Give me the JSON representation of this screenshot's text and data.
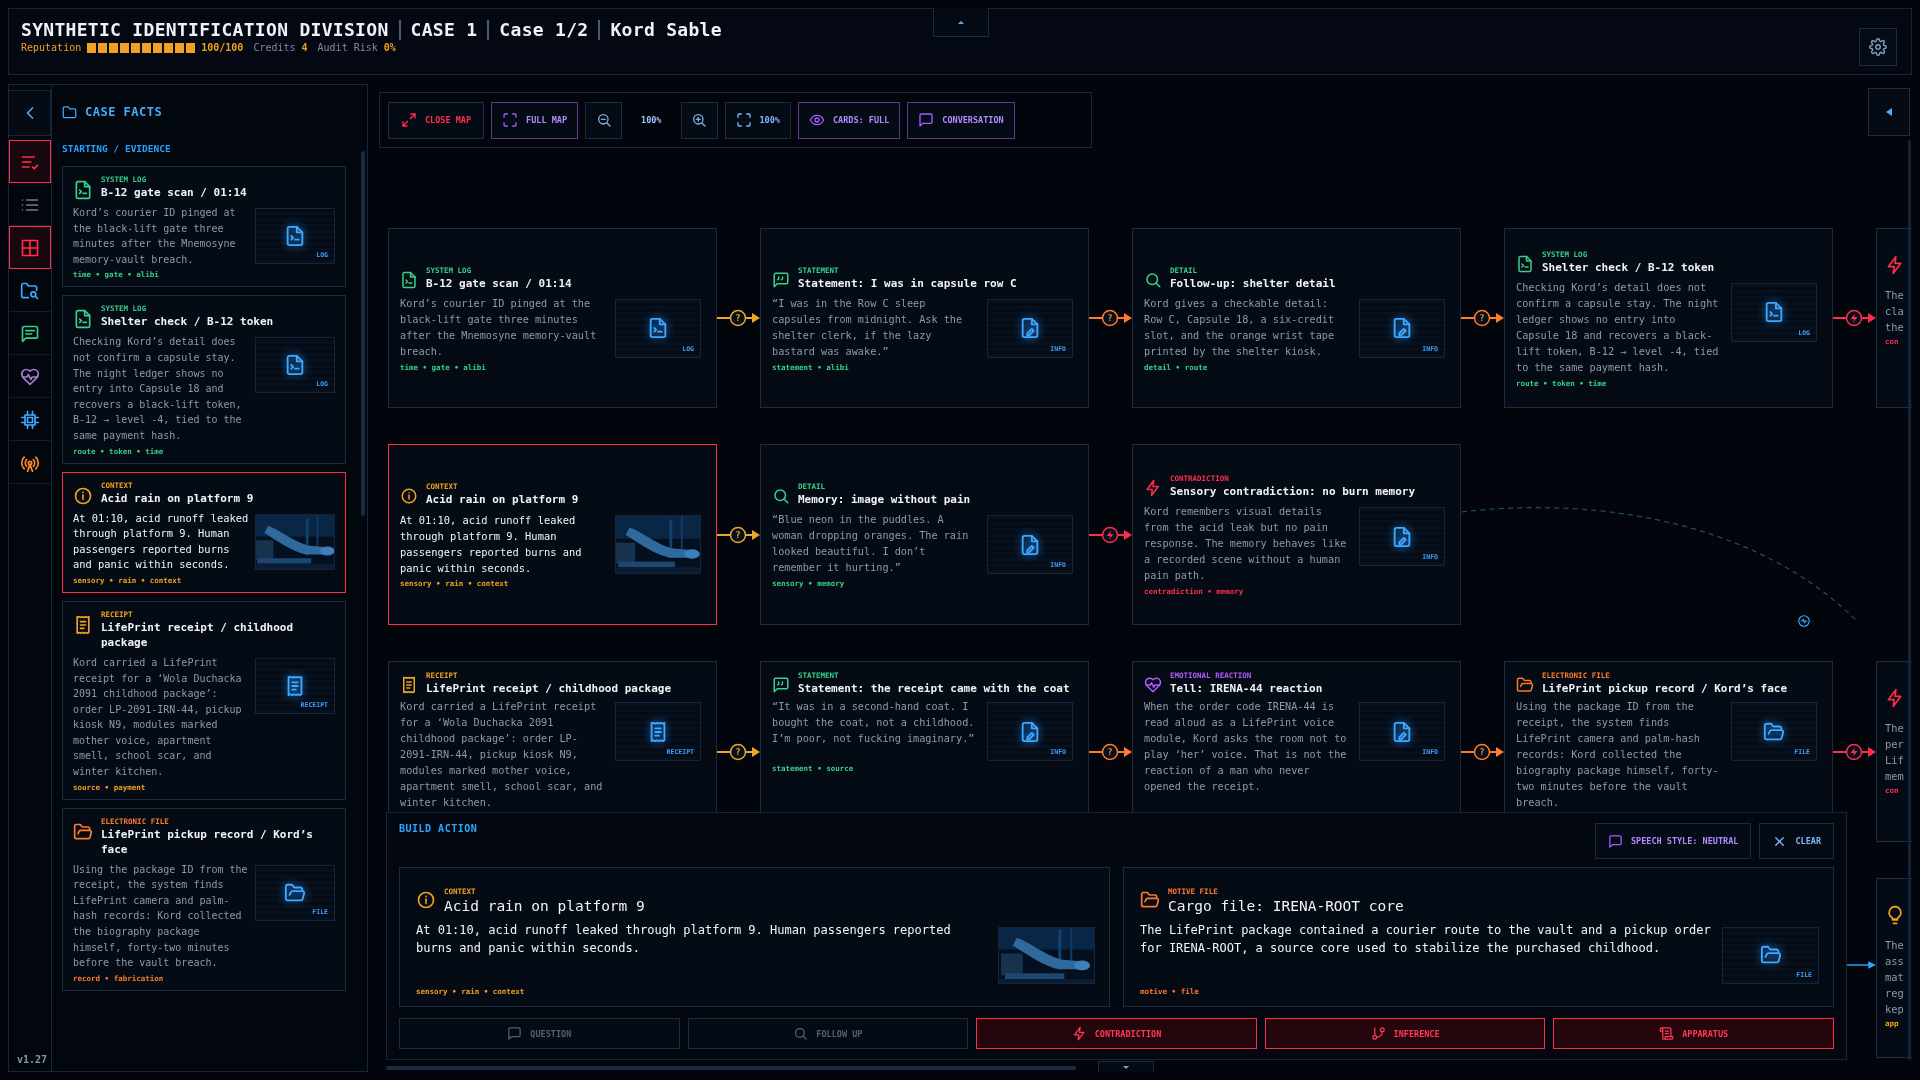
{
  "header": {
    "titles": [
      "SYNTHETIC IDENTIFICATION DIVISION",
      "CASE 1",
      "Case 1/2",
      "Kord Sable"
    ],
    "stats": [
      {
        "kind": "bar",
        "label": "Reputation",
        "level": 1,
        "value": "100/100"
      },
      {
        "kind": "plain",
        "label": "Credits",
        "value": "4"
      },
      {
        "kind": "plain",
        "label": "Audit Risk",
        "value": "0%"
      }
    ]
  },
  "rail": {
    "items": [
      {
        "kind": "checklist",
        "selected": true
      },
      {
        "kind": "list",
        "selected": false
      },
      {
        "kind": "grid",
        "selected": true
      },
      {
        "kind": "folder-search",
        "selected": false
      },
      {
        "kind": "chat",
        "selected": false
      },
      {
        "kind": "heart",
        "selected": false
      },
      {
        "kind": "chip",
        "selected": false
      },
      {
        "kind": "antenna",
        "selected": false
      }
    ],
    "version": "v1.27"
  },
  "facts": {
    "title": "CASE FACTS",
    "section": "STARTING / EVIDENCE",
    "cards": [
      {
        "kind": "log",
        "type": "SYSTEM LOG",
        "title": "B-12 gate scan / 01:14",
        "text": "Kord’s courier ID pinged at the black-lift gate three minutes after the Mnemosyne memory-vault breach.",
        "thumb": {
          "kind": "log",
          "label": "LOG"
        },
        "tags": "time • gate • alibi",
        "selected": false
      },
      {
        "kind": "log",
        "type": "SYSTEM LOG",
        "title": "Shelter check / B-12 token",
        "text": "Checking Kord’s detail does not confirm a capsule stay. The night ledger shows no entry into Capsule 18 and recovers a black-lift token, B-12 → level -4, tied to the same payment hash.",
        "thumb": {
          "kind": "log",
          "label": "LOG"
        },
        "tags": "route • token • time",
        "selected": false
      },
      {
        "kind": "context",
        "type": "CONTEXT",
        "title": "Acid rain on platform 9",
        "text": "At 01:10, acid runoff leaked through platform 9. Human passengers reported burns and panic within seconds.",
        "tags": "sensory • rain • context",
        "selected": true
      },
      {
        "kind": "receipt",
        "type": "RECEIPT",
        "title": "LifePrint receipt / childhood package",
        "text": "Kord carried a LifePrint receipt for a ‘Wola Duchacka 2091 childhood package’: order LP-2091-IRN-44, pickup kiosk N9, modules marked mother voice, apartment smell, school scar, and winter kitchen.",
        "thumb": {
          "kind": "receipt",
          "label": "RECEIPT"
        },
        "tags": "source • payment",
        "selected": false
      },
      {
        "kind": "file",
        "type": "ELECTRONIC FILE",
        "title": "LifePrint pickup record / Kord’s face",
        "text": "Using the package ID from the receipt, the system finds LifePrint camera and palm-hash records: Kord collected the biography package himself, forty-two minutes before the vault breach.",
        "thumb": {
          "kind": "file",
          "label": "FILE"
        },
        "tags": "record • fabrication",
        "selected": false
      }
    ]
  },
  "toolbar": [
    {
      "kind": "close",
      "label": "CLOSE MAP"
    },
    {
      "kind": "full",
      "label": "FULL MAP"
    },
    {
      "kind": "zoom-out"
    },
    {
      "kind": "zoom-level",
      "label": "100%"
    },
    {
      "kind": "zoom-in"
    },
    {
      "kind": "fit",
      "label": "100%"
    },
    {
      "kind": "cards",
      "label": "CARDS: FULL"
    },
    {
      "kind": "conversation",
      "label": "CONVERSATION"
    }
  ],
  "map": {
    "rows": [
      {
        "cards": [
          {
            "kind": "log",
            "type": "SYSTEM LOG",
            "title": "B-12 gate scan / 01:14",
            "text": "Kord’s courier ID pinged at the black-lift gate three minutes after the Mnemosyne memory-vault breach.",
            "thumb": {
              "kind": "log",
              "label": "LOG"
            },
            "tags": "time • gate • alibi",
            "selected": false
          },
          {
            "kind": "statement",
            "type": "STATEMENT",
            "title": "Statement: I was in capsule row C",
            "text": "“I was in the Row C sleep capsules from midnight. Ask the shelter clerk, if the lazy bastard was awake.”",
            "thumb": {
              "kind": "info",
              "label": "INFO"
            },
            "tags": "statement • alibi",
            "selected": false
          },
          {
            "kind": "detail",
            "type": "DETAIL",
            "title": "Follow-up: shelter detail",
            "text": "Kord gives a checkable detail: Row C, Capsule 18, a six-credit slot, and the orange wrist tape printed by the shelter kiosk.",
            "thumb": {
              "kind": "info",
              "label": "INFO"
            },
            "tags": "detail • route",
            "selected": false
          },
          {
            "kind": "log",
            "type": "SYSTEM LOG",
            "title": "Shelter check / B-12 token",
            "text": "Checking Kord’s detail does not confirm a capsule stay. The night ledger shows no entry into Capsule 18 and recovers a black-lift token, B-12 → level -4, tied to the same payment hash.",
            "thumb": {
              "kind": "log",
              "label": "LOG"
            },
            "tags": "route • token • time",
            "selected": false
          }
        ],
        "links": [
          {
            "kind": "question",
            "label": "?",
            "color": "#e8a82a"
          },
          {
            "kind": "question",
            "label": "?",
            "color": "#ff7a2a"
          },
          {
            "kind": "question",
            "label": "?",
            "color": "#ff7a2a"
          },
          {
            "kind": "contradiction",
            "color": "#ff2d4a"
          }
        ]
      },
      {
        "cards": [
          {
            "kind": "context",
            "type": "CONTEXT",
            "title": "Acid rain on platform 9",
            "text": "At 01:10, acid runoff leaked through platform 9. Human passengers reported burns and panic within seconds.",
            "tags": "sensory • rain • context",
            "selected": true
          },
          {
            "kind": "detail",
            "type": "DETAIL",
            "title": "Memory: image without pain",
            "text": "“Blue neon in the puddles. A woman dropping oranges. The rain looked beautiful. I don’t remember it hurting.”",
            "thumb": {
              "kind": "info",
              "label": "INFO"
            },
            "tags": "sensory • memory",
            "selected": false
          },
          {
            "kind": "contradiction",
            "type": "CONTRADICTION",
            "title": "Sensory contradiction: no burn memory",
            "text": "Kord remembers visual details from the acid leak but no pain response. The memory behaves like a recorded scene without a human pain path.",
            "thumb": {
              "kind": "info",
              "label": "INFO"
            },
            "tags": "contradiction • memory",
            "selected": false
          }
        ],
        "links": [
          {
            "kind": "question",
            "label": "?",
            "color": "#e8a82a"
          },
          {
            "kind": "contradiction",
            "color": "#ff2d4a"
          }
        ]
      },
      {
        "cards": [
          {
            "kind": "receipt",
            "type": "RECEIPT",
            "title": "LifePrint receipt / childhood package",
            "text": "Kord carried a LifePrint receipt for a ‘Wola Duchacka 2091 childhood package’: order LP-2091-IRN-44, pickup kiosk N9, modules marked mother voice, apartment smell, school scar, and winter kitchen.",
            "thumb": {
              "kind": "receipt",
              "label": "RECEIPT"
            },
            "selected": false
          },
          {
            "kind": "statement",
            "type": "STATEMENT",
            "title": "Statement: the receipt came with the coat",
            "text": "“It was in a second-hand coat. I bought the coat, not a childhood. I’m poor, not fucking imaginary.”",
            "thumb": {
              "kind": "info",
              "label": "INFO"
            },
            "tags": "statement • source",
            "selected": false
          },
          {
            "kind": "emotion",
            "type": "EMOTIONAL REACTION",
            "title": "Tell: IRENA-44 reaction",
            "text": "When the order code IRENA-44 is read aloud as a LifePrint voice module, Kord asks the room not to play ‘her’ voice. That is not the reaction of a man who never opened the receipt.",
            "thumb": {
              "kind": "info",
              "label": "INFO"
            },
            "selected": false
          },
          {
            "kind": "file",
            "type": "ELECTRONIC FILE",
            "title": "LifePrint pickup record / Kord’s face",
            "text": "Using the package ID from the receipt, the system finds LifePrint camera and palm-hash records: Kord collected the biography package himself, forty-two minutes before the vault breach.",
            "thumb": {
              "kind": "file",
              "label": "FILE"
            },
            "selected": false
          }
        ],
        "links": [
          {
            "kind": "question",
            "label": "?",
            "color": "#e8a82a"
          },
          {
            "kind": "question",
            "label": "?",
            "color": "#ff7a2a"
          },
          {
            "kind": "question",
            "label": "?",
            "color": "#ff7a2a"
          },
          {
            "kind": "contradiction",
            "color": "#ff2d4a"
          }
        ]
      }
    ],
    "edge_cards": [
      {
        "kind": "contradiction",
        "lines": [
          "The",
          "cla",
          "the"
        ],
        "tags": "con"
      },
      {
        "kind": "contradiction",
        "lines": [
          "The",
          "per",
          "Lif",
          "mem"
        ],
        "tags": "con"
      },
      {
        "kind": "insight",
        "lines": [
          "The",
          "ass",
          "mat",
          "reg",
          "kep"
        ],
        "tags": "app"
      }
    ]
  },
  "build": {
    "title": "BUILD ACTION",
    "buttons": [
      {
        "kind": "speech",
        "label": "SPEECH STYLE: NEUTRAL"
      },
      {
        "kind": "clear",
        "label": "CLEAR"
      }
    ],
    "cards": [
      {
        "kind": "context",
        "type": "CONTEXT",
        "title": "Acid rain on platform 9",
        "text": "At 01:10, acid runoff leaked through platform 9. Human passengers reported burns and panic within seconds.",
        "tags": "sensory • rain • context"
      },
      {
        "kind": "motive",
        "type": "MOTIVE FILE",
        "title": "Cargo file: IRENA-ROOT core",
        "text": "The LifePrint package contained a courier route to the vault and a pickup order for IRENA-ROOT, a source core used to stabilize the purchased childhood.",
        "thumb": {
          "kind": "file",
          "label": "FILE"
        },
        "tags": "motive • file"
      }
    ],
    "actions": [
      {
        "kind": "question",
        "label": "QUESTION",
        "disabled": true
      },
      {
        "kind": "follow",
        "label": "FOLLOW UP",
        "disabled": true
      },
      {
        "kind": "contradiction",
        "label": "CONTRADICTION",
        "disabled": false
      },
      {
        "kind": "inference",
        "label": "INFERENCE",
        "disabled": false
      },
      {
        "kind": "apparatus",
        "label": "APPARATUS",
        "disabled": false
      }
    ]
  }
}
